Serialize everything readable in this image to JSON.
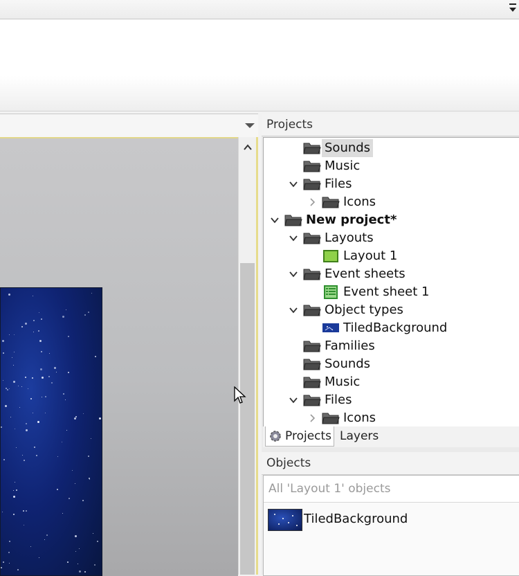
{
  "projects_panel": {
    "title": "Projects",
    "tree": [
      {
        "label": "Sounds",
        "indent": 2,
        "expander": "none",
        "icon": "folder-icon",
        "bold": false,
        "selected": true
      },
      {
        "label": "Music",
        "indent": 2,
        "expander": "none",
        "icon": "folder-icon",
        "bold": false,
        "selected": false
      },
      {
        "label": "Files",
        "indent": 2,
        "expander": "expanded",
        "icon": "folder-icon",
        "bold": false,
        "selected": false
      },
      {
        "label": "Icons",
        "indent": 3,
        "expander": "collapsed",
        "icon": "folder-icon",
        "bold": false,
        "selected": false
      },
      {
        "label": "New project*",
        "indent": 1,
        "expander": "expanded",
        "icon": "folder-icon",
        "bold": true,
        "selected": false
      },
      {
        "label": "Layouts",
        "indent": 2,
        "expander": "expanded",
        "icon": "folder-icon",
        "bold": false,
        "selected": false
      },
      {
        "label": "Layout 1",
        "indent": 3,
        "expander": "none",
        "icon": "layout-icon",
        "bold": false,
        "selected": false
      },
      {
        "label": "Event sheets",
        "indent": 2,
        "expander": "expanded",
        "icon": "folder-icon",
        "bold": false,
        "selected": false
      },
      {
        "label": "Event sheet 1",
        "indent": 3,
        "expander": "none",
        "icon": "event-sheet-icon",
        "bold": false,
        "selected": false
      },
      {
        "label": "Object types",
        "indent": 2,
        "expander": "expanded",
        "icon": "folder-icon",
        "bold": false,
        "selected": false
      },
      {
        "label": "TiledBackground",
        "indent": 3,
        "expander": "none",
        "icon": "tiled-background-icon",
        "bold": false,
        "selected": false
      },
      {
        "label": "Families",
        "indent": 2,
        "expander": "none",
        "icon": "folder-icon",
        "bold": false,
        "selected": false
      },
      {
        "label": "Sounds",
        "indent": 2,
        "expander": "none",
        "icon": "folder-icon",
        "bold": false,
        "selected": false
      },
      {
        "label": "Music",
        "indent": 2,
        "expander": "none",
        "icon": "folder-icon",
        "bold": false,
        "selected": false
      },
      {
        "label": "Files",
        "indent": 2,
        "expander": "expanded",
        "icon": "folder-icon",
        "bold": false,
        "selected": false
      },
      {
        "label": "Icons",
        "indent": 3,
        "expander": "collapsed",
        "icon": "folder-icon",
        "bold": false,
        "selected": false
      }
    ],
    "tabs": [
      {
        "label": "Projects",
        "active": true,
        "icon": "gear-icon"
      },
      {
        "label": "Layers",
        "active": false,
        "icon": ""
      }
    ]
  },
  "objects_panel": {
    "title": "Objects",
    "filter_text": "All 'Layout 1' objects",
    "items": [
      {
        "label": "TiledBackground",
        "icon": "tiled-background-thumbnail"
      }
    ]
  },
  "colors": {
    "folder": "#5a5a5a",
    "layout_green": "#6cbf2a",
    "event_green": "#3ea33e",
    "canvas_blue": "#0f2372",
    "editor_border": "#e6dc8c"
  }
}
